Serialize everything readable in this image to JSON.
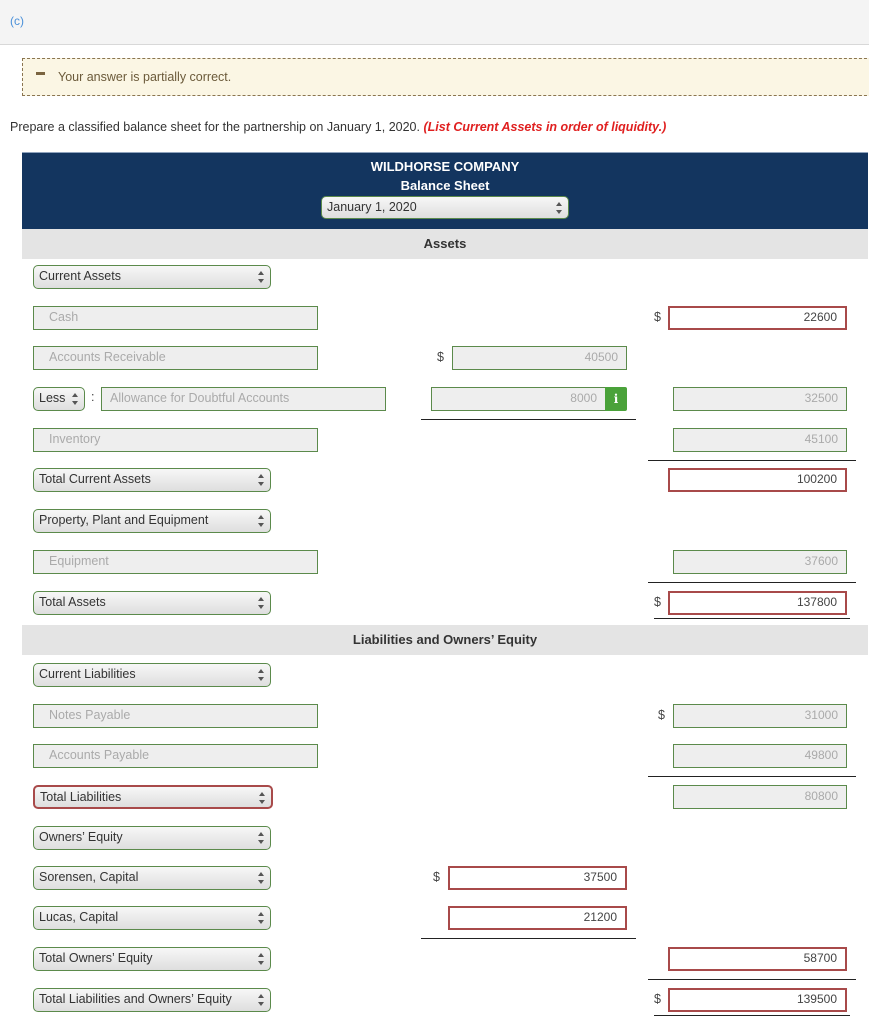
{
  "part_label": "(c)",
  "feedback": {
    "message": "Your answer is partially correct.",
    "icon": "minus-icon"
  },
  "instructions": {
    "text": "Prepare a classified balance sheet for the partnership on January 1, 2020.",
    "hint": "(List Current Assets in order of liquidity.)"
  },
  "header": {
    "company": "WILDHORSE COMPANY",
    "title": "Balance Sheet",
    "date_select": "January 1, 2020"
  },
  "sections": {
    "assets": "Assets",
    "liabilities_equity": "Liabilities and Owners’ Equity"
  },
  "assets": {
    "current_assets_select": "Current Assets",
    "cash": {
      "label": "Cash",
      "value": "22600",
      "status": "incorrect"
    },
    "accounts_receivable": {
      "label": "Accounts Receivable",
      "value": "40500",
      "status": "correct"
    },
    "less_select": "Less",
    "allowance": {
      "label": "Allowance for Doubtful Accounts",
      "value": "8000",
      "status": "correct",
      "net_value": "32500"
    },
    "inventory": {
      "label": "Inventory",
      "value": "45100",
      "status": "correct"
    },
    "total_current_assets_select": "Total Current Assets",
    "total_current_assets_value": "100200",
    "ppe_select": "Property, Plant and Equipment",
    "equipment": {
      "label": "Equipment",
      "value": "37600",
      "status": "correct"
    },
    "total_assets_select": "Total Assets",
    "total_assets_value": "137800"
  },
  "liabilities": {
    "current_liabilities_select": "Current Liabilities",
    "notes_payable": {
      "label": "Notes Payable",
      "value": "31000",
      "status": "correct"
    },
    "accounts_payable": {
      "label": "Accounts Payable",
      "value": "49800",
      "status": "correct"
    },
    "total_liabilities_select": "Total Liabilities",
    "total_liabilities_value": "80800"
  },
  "equity": {
    "owners_equity_select": "Owners’ Equity",
    "sorensen_select": "Sorensen, Capital",
    "sorensen_value": "37500",
    "lucas_select": "Lucas, Capital",
    "lucas_value": "21200",
    "total_equity_select": "Total Owners’ Equity",
    "total_equity_value": "58700",
    "total_le_select": "Total Liabilities and Owners’ Equity",
    "total_le_value": "139500"
  },
  "currency_symbol": "$",
  "colors": {
    "header_bg": "#13355f",
    "correct_border": "#5b8a4b",
    "incorrect_border": "#a84a4a",
    "hint_red": "#e02020",
    "info_green": "#4aa23a"
  }
}
